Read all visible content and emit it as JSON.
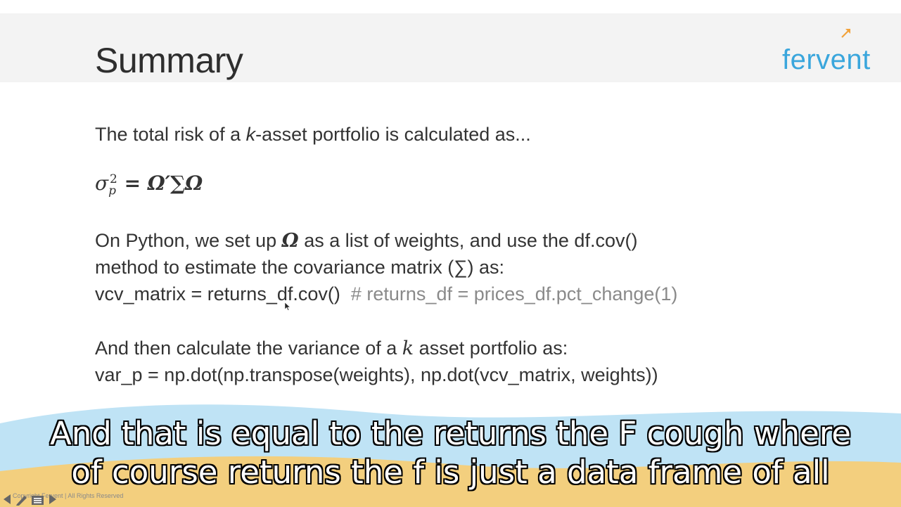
{
  "slide": {
    "title": "Summary",
    "logo": "fervent",
    "line1_a": "The total risk of a ",
    "line1_k": "k",
    "line1_b": "-asset portfolio is calculated as...",
    "formula_sigma": "σ",
    "formula_sub": "p",
    "formula_sup": "2",
    "formula_rest": " = Ω′∑Ω",
    "python_a": "On Python, we set up ",
    "python_omega": "Ω",
    "python_b": " as a list of weights, and use the df.cov()",
    "method_line": "method to estimate the covariance matrix (∑) as:",
    "vcv_code": "vcv_matrix = returns_df.cov()",
    "vcv_comment": "# returns_df = prices_df.pct_change(1)",
    "then_a": "And then calculate the variance of a ",
    "then_k": "k",
    "then_b": " asset portfolio as:",
    "var_code": "var_p = np.dot(np.transpose(weights), np.dot(vcv_matrix, weights))",
    "copyright": "Copyright Fervent | All Rights Reserved"
  },
  "captions": {
    "line1": "And that is equal to the returns the F cough where",
    "line2": "of course returns the f is just a data frame of all"
  },
  "colors": {
    "logo": "#3aa6dc",
    "band_sky": "#bfe3f5",
    "band_sand": "#f3cf7e",
    "comment": "#8a8a8a"
  },
  "icons": [
    "arrow-left-icon",
    "pen-icon",
    "menu-icon",
    "arrow-right-icon"
  ]
}
